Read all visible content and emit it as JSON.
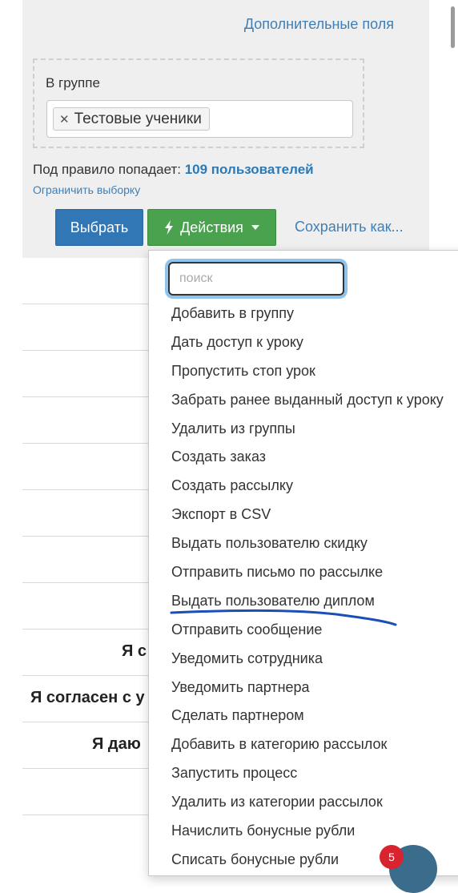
{
  "filter": {
    "extra_fields_link": "Дополнительные поля",
    "group_label": "В группе",
    "group_tag": "Тестовые ученики",
    "rule_prefix": "Под правило попадает:",
    "rule_count": "109 пользователей",
    "limit_link": "Ограничить выборку"
  },
  "toolbar": {
    "select_label": "Выбрать",
    "actions_label": "Действия",
    "save_as_label": "Сохранить как..."
  },
  "background_rows": [
    "Я с",
    "Я согласен с у",
    "Я даю"
  ],
  "dropdown": {
    "search_placeholder": "поиск",
    "items": [
      "Добавить в группу",
      "Дать доступ к уроку",
      "Пропустить стоп урок",
      "Забрать ранее выданный доступ к уроку",
      "Удалить из группы",
      "Создать заказ",
      "Создать рассылку",
      "Экспорт в CSV",
      "Выдать пользователю скидку",
      "Отправить письмо по рассылке",
      "Выдать пользователю диплом",
      "Отправить сообщение",
      "Уведомить сотрудника",
      "Уведомить партнера",
      "Сделать партнером",
      "Добавить в категорию рассылок",
      "Запустить процесс",
      "Удалить из категории рассылок",
      "Начислить бонусные рубли",
      "Списать бонусные рубли"
    ]
  },
  "chat_widget": {
    "badge_count": "5"
  },
  "colors": {
    "link": "#3f7fb6",
    "select_button": "#3277b5",
    "actions_button": "#4aa24f",
    "annotation_stroke": "#1b4fb8",
    "badge": "#d9232e"
  }
}
